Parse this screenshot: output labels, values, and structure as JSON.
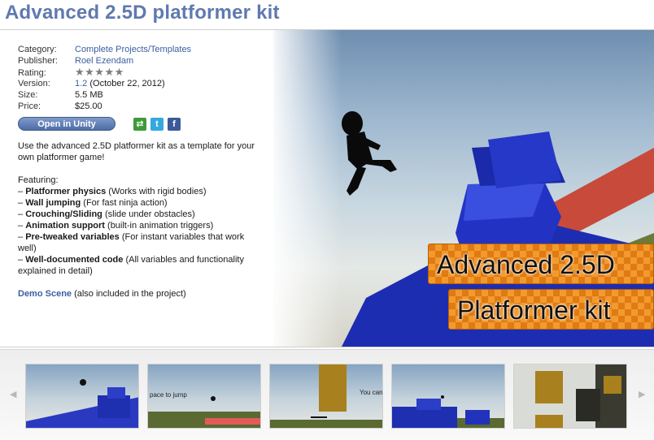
{
  "page": {
    "title": "Advanced 2.5D platformer kit"
  },
  "meta": {
    "category": {
      "label": "Category:",
      "value": "Complete Projects/Templates"
    },
    "publisher": {
      "label": "Publisher:",
      "value": "Roel Ezendam"
    },
    "rating": {
      "label": "Rating:",
      "stars": "★★★★★",
      "value": 5
    },
    "version": {
      "label": "Version:",
      "number": "1.2",
      "date": "(October 22, 2012)"
    },
    "size": {
      "label": "Size:",
      "value": "5.5 MB"
    },
    "price": {
      "label": "Price:",
      "value": "$25.00"
    }
  },
  "actions": {
    "open_label": "Open in Unity",
    "share": [
      {
        "icon": "share-icon",
        "glyph": "⇄"
      },
      {
        "icon": "twitter-icon",
        "glyph": "t"
      },
      {
        "icon": "facebook-icon",
        "glyph": "f"
      }
    ]
  },
  "description": {
    "intro": "Use the advanced 2.5D platformer kit as a template for your own platformer game!",
    "featuring_label": "Featuring:",
    "features": [
      {
        "bullet": "– ",
        "bold": "Platformer physics",
        "rest": " (Works with rigid bodies)"
      },
      {
        "bullet": "– ",
        "bold": "Wall jumping",
        "rest": " (For fast ninja action)"
      },
      {
        "bullet": "– ",
        "bold": "Crouching/Sliding",
        "rest": " (slide under obstacles)"
      },
      {
        "bullet": "– ",
        "bold": "Animation support",
        "rest": " (built-in animation triggers)"
      },
      {
        "bullet": "– ",
        "bold": "Pre-tweaked variables",
        "rest": " (For instant variables that work well)"
      },
      {
        "bullet": "– ",
        "bold": "Well-documented code",
        "rest": " (All variables and functionality explained in detail)"
      }
    ],
    "demo_link": "Demo Scene",
    "demo_note": " (also included in the project)"
  },
  "hero": {
    "line1": "Advanced 2.5D",
    "line2": "Platformer kit"
  },
  "gallery": {
    "prev_icon": "◀",
    "next_icon": "▶",
    "thumbs": [
      {
        "caption": ""
      },
      {
        "caption": "pace to jump"
      },
      {
        "caption": "You can"
      },
      {
        "caption": ""
      },
      {
        "caption": ""
      }
    ]
  },
  "colors": {
    "title": "#5f79b0",
    "link": "#3a5fa0",
    "button": "#5a78b0",
    "banner": "#ec8a1c",
    "block_blue": "#1a2fb5",
    "block_red": "#c84a3a"
  }
}
